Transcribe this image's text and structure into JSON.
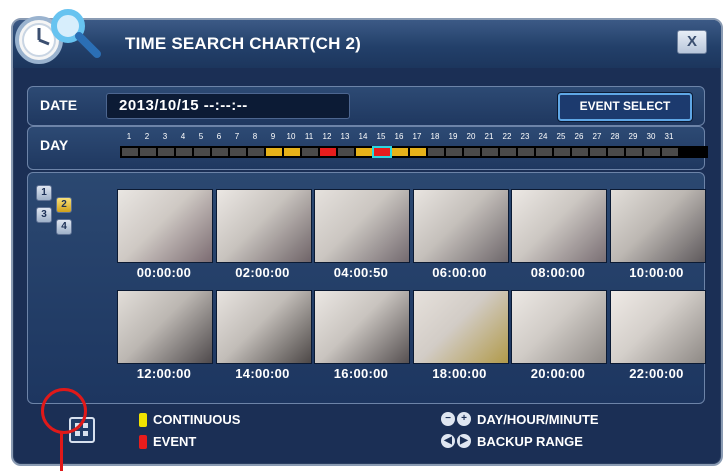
{
  "window": {
    "title": "TIME SEARCH CHART(CH 2)",
    "close_label": "X",
    "icon": "clock-magnifier-icon"
  },
  "date_row": {
    "label": "DATE",
    "value": "2013/10/15  --:--:--",
    "event_select_label": "EVENT SELECT"
  },
  "day_row": {
    "label": "DAY",
    "days": [
      "1",
      "2",
      "3",
      "4",
      "5",
      "6",
      "7",
      "8",
      "9",
      "10",
      "11",
      "12",
      "13",
      "14",
      "15",
      "16",
      "17",
      "18",
      "19",
      "20",
      "21",
      "22",
      "23",
      "24",
      "25",
      "26",
      "27",
      "28",
      "29",
      "30",
      "31"
    ],
    "states": [
      "none",
      "none",
      "none",
      "none",
      "none",
      "none",
      "none",
      "none",
      "cont",
      "cont",
      "none",
      "evt",
      "none",
      "cont",
      "evt",
      "cont",
      "cont",
      "none",
      "none",
      "none",
      "none",
      "none",
      "none",
      "none",
      "none",
      "none",
      "none",
      "none",
      "none",
      "none",
      "none"
    ],
    "selected_day": "15"
  },
  "channels": [
    "1",
    "2",
    "3",
    "4"
  ],
  "selected_channel": "2",
  "thumbnails": [
    {
      "time": "00:00:00"
    },
    {
      "time": "02:00:00"
    },
    {
      "time": "04:00:50"
    },
    {
      "time": "06:00:00"
    },
    {
      "time": "08:00:00"
    },
    {
      "time": "10:00:00"
    },
    {
      "time": "12:00:00"
    },
    {
      "time": "14:00:00"
    },
    {
      "time": "16:00:00"
    },
    {
      "time": "18:00:00"
    },
    {
      "time": "20:00:00"
    },
    {
      "time": "22:00:00"
    }
  ],
  "legend": {
    "continuous_label": "CONTINUOUS",
    "event_label": "EVENT",
    "day_hour_minute_label": "DAY/HOUR/MINUTE",
    "backup_range_label": "BACKUP RANGE",
    "colors": {
      "continuous": "#f1e300",
      "event": "#e81c1c",
      "cont_bar": "#e6b21a",
      "evt_bar": "#e61d1d"
    }
  }
}
